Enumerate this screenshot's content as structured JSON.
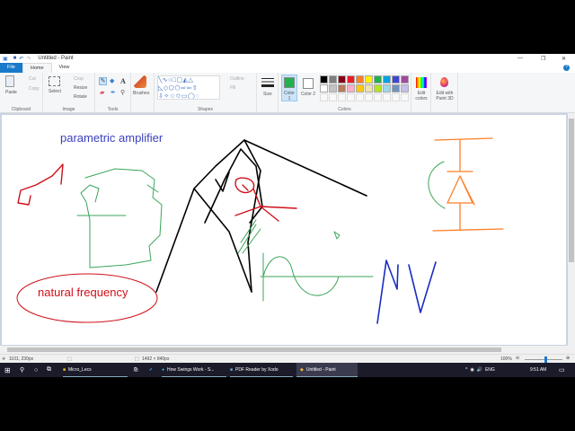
{
  "window": {
    "title": "Untitled - Paint",
    "minimize": "—",
    "maximize": "❐",
    "close": "✕",
    "help": "?"
  },
  "tabs": [
    "File",
    "Home",
    "View"
  ],
  "clipboard": {
    "paste": "Paste",
    "cut": "Cut",
    "copy": "Copy",
    "label": "Clipboard"
  },
  "image": {
    "select": "Select",
    "crop": "Crop",
    "resize": "Resize",
    "rotate": "Rotate",
    "label": "Image"
  },
  "tools": {
    "label": "Tools",
    "brushes": "Brushes"
  },
  "shapes": {
    "label": "Shapes",
    "outline": "Outline",
    "fill": "Fill"
  },
  "size": {
    "label": "Size"
  },
  "colors": {
    "color1": "Color 1",
    "color2": "Color 2",
    "edit": "Edit colors",
    "label": "Colors",
    "color1_value": "#22b14c",
    "color2_value": "#ffffff",
    "palette": [
      "#000000",
      "#7f7f7f",
      "#880015",
      "#ed1c24",
      "#ff7f27",
      "#fff200",
      "#22b14c",
      "#00a2e8",
      "#3f48cc",
      "#a349a4",
      "#ffffff",
      "#c3c3c3",
      "#b97a57",
      "#ffaec9",
      "#ffc90e",
      "#efe4b0",
      "#b5e61d",
      "#99d9ea",
      "#7092be",
      "#c8bfe7"
    ]
  },
  "paint3d": {
    "label": "Edit with Paint 3D"
  },
  "canvas_text": {
    "title": "parametric amplifier",
    "note": "natural frequency"
  },
  "status": {
    "cursor": "1101, 230px",
    "size": "1492 × 840px",
    "zoom": "100%",
    "zoom_fraction": 0.55
  },
  "taskbar": {
    "items": [
      "Micro_Lecs",
      "How Swings Work - S...",
      "PDF Reader by Xodo",
      "Untitled - Paint"
    ],
    "lang": "ENG",
    "time": "9:51 AM"
  }
}
